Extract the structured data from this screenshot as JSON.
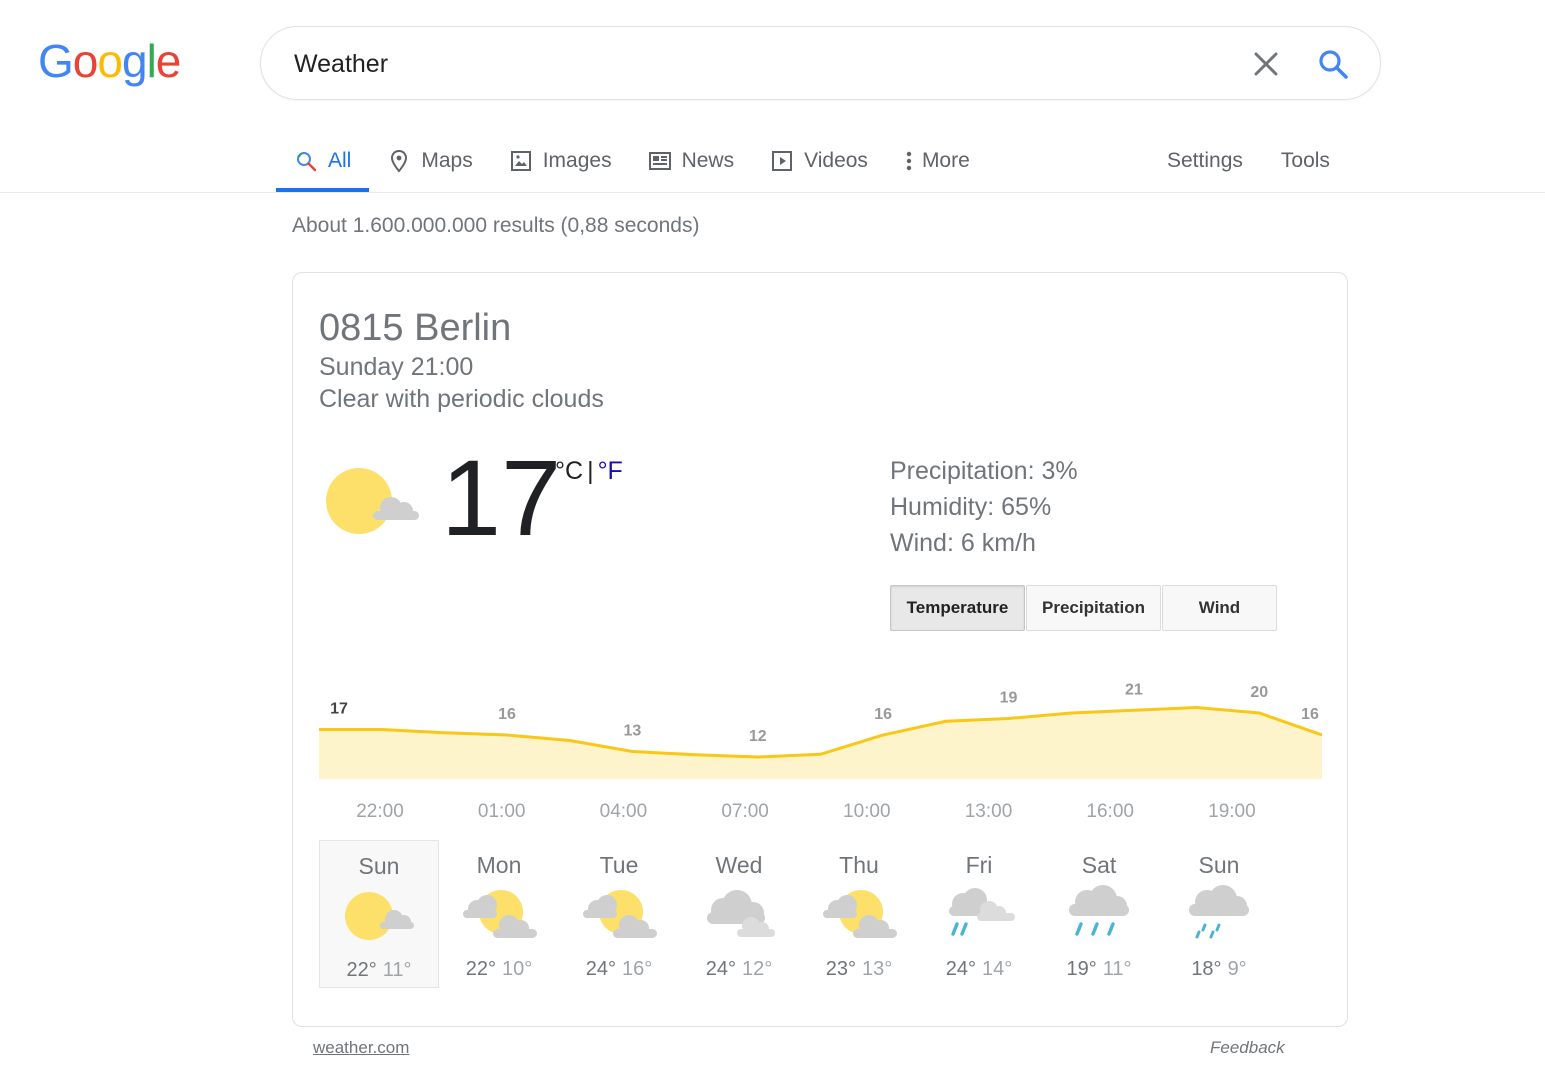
{
  "logo": {
    "letters": [
      "G",
      "o",
      "o",
      "g",
      "l",
      "e"
    ],
    "colors": [
      "#4285F4",
      "#EA4335",
      "#FBBC05",
      "#4285F4",
      "#34A853",
      "#EA4335"
    ]
  },
  "search": {
    "value": "Weather",
    "clear_icon": "close-icon",
    "search_icon": "search-icon"
  },
  "tabs": [
    {
      "label": "All",
      "icon": "search-icon",
      "active": true
    },
    {
      "label": "Maps",
      "icon": "map-pin-icon"
    },
    {
      "label": "Images",
      "icon": "image-icon"
    },
    {
      "label": "News",
      "icon": "news-icon"
    },
    {
      "label": "Videos",
      "icon": "video-icon"
    },
    {
      "label": "More",
      "icon": "more-vertical-icon"
    }
  ],
  "tabs_right": [
    {
      "label": "Settings"
    },
    {
      "label": "Tools"
    }
  ],
  "result_stats": "About 1.600.000.000 results (0,88 seconds)",
  "weather": {
    "location": "0815 Berlin",
    "datetime": "Sunday 21:00",
    "condition": "Clear with periodic clouds",
    "temperature": "17",
    "unit_c": "°C",
    "unit_sep": "|",
    "unit_f": "°F",
    "precipitation": "Precipitation: 3%",
    "humidity": "Humidity: 65%",
    "wind": "Wind: 6 km/h",
    "chart_tabs": [
      {
        "label": "Temperature",
        "active": true
      },
      {
        "label": "Precipitation"
      },
      {
        "label": "Wind"
      }
    ],
    "forecast": [
      {
        "day": "Sun",
        "hi": "22°",
        "lo": "11°",
        "icon": "partly-sunny-icon",
        "selected": true
      },
      {
        "day": "Mon",
        "hi": "22°",
        "lo": "10°",
        "icon": "mostly-cloudy-sun-icon"
      },
      {
        "day": "Tue",
        "hi": "24°",
        "lo": "16°",
        "icon": "mostly-cloudy-sun-icon"
      },
      {
        "day": "Wed",
        "hi": "24°",
        "lo": "12°",
        "icon": "cloudy-icon"
      },
      {
        "day": "Thu",
        "hi": "23°",
        "lo": "13°",
        "icon": "mostly-cloudy-sun-icon"
      },
      {
        "day": "Fri",
        "hi": "24°",
        "lo": "14°",
        "icon": "cloudy-showers-icon"
      },
      {
        "day": "Sat",
        "hi": "19°",
        "lo": "11°",
        "icon": "rain-icon"
      },
      {
        "day": "Sun",
        "hi": "18°",
        "lo": "9°",
        "icon": "light-rain-icon"
      }
    ]
  },
  "chart_data": {
    "type": "area",
    "x": [
      "21:00",
      "22:00",
      "00:00",
      "01:00",
      "03:00",
      "04:00",
      "06:00",
      "07:00",
      "09:00",
      "10:00",
      "12:00",
      "13:00",
      "15:00",
      "16:00",
      "18:00",
      "19:00",
      "21:00"
    ],
    "values": [
      17,
      17,
      16.4,
      16,
      15,
      13,
      12.4,
      12,
      12.5,
      16,
      18.5,
      19,
      20,
      20.5,
      21,
      20,
      16
    ],
    "point_labels": [
      {
        "text": "17",
        "index": 0
      },
      {
        "text": "16",
        "index": 3
      },
      {
        "text": "13",
        "index": 5
      },
      {
        "text": "12",
        "index": 7
      },
      {
        "text": "16",
        "index": 9
      },
      {
        "text": "19",
        "index": 11
      },
      {
        "text": "21",
        "index": 13
      },
      {
        "text": "20",
        "index": 15
      },
      {
        "text": "16",
        "index": 16
      }
    ],
    "tick_labels": [
      "22:00",
      "01:00",
      "04:00",
      "07:00",
      "10:00",
      "13:00",
      "16:00",
      "19:00"
    ],
    "ylim": [
      8,
      24
    ],
    "line_color": "#F9C716",
    "fill_color": "#FEF4CB"
  },
  "footer": {
    "source": "weather.com",
    "feedback": "Feedback"
  }
}
